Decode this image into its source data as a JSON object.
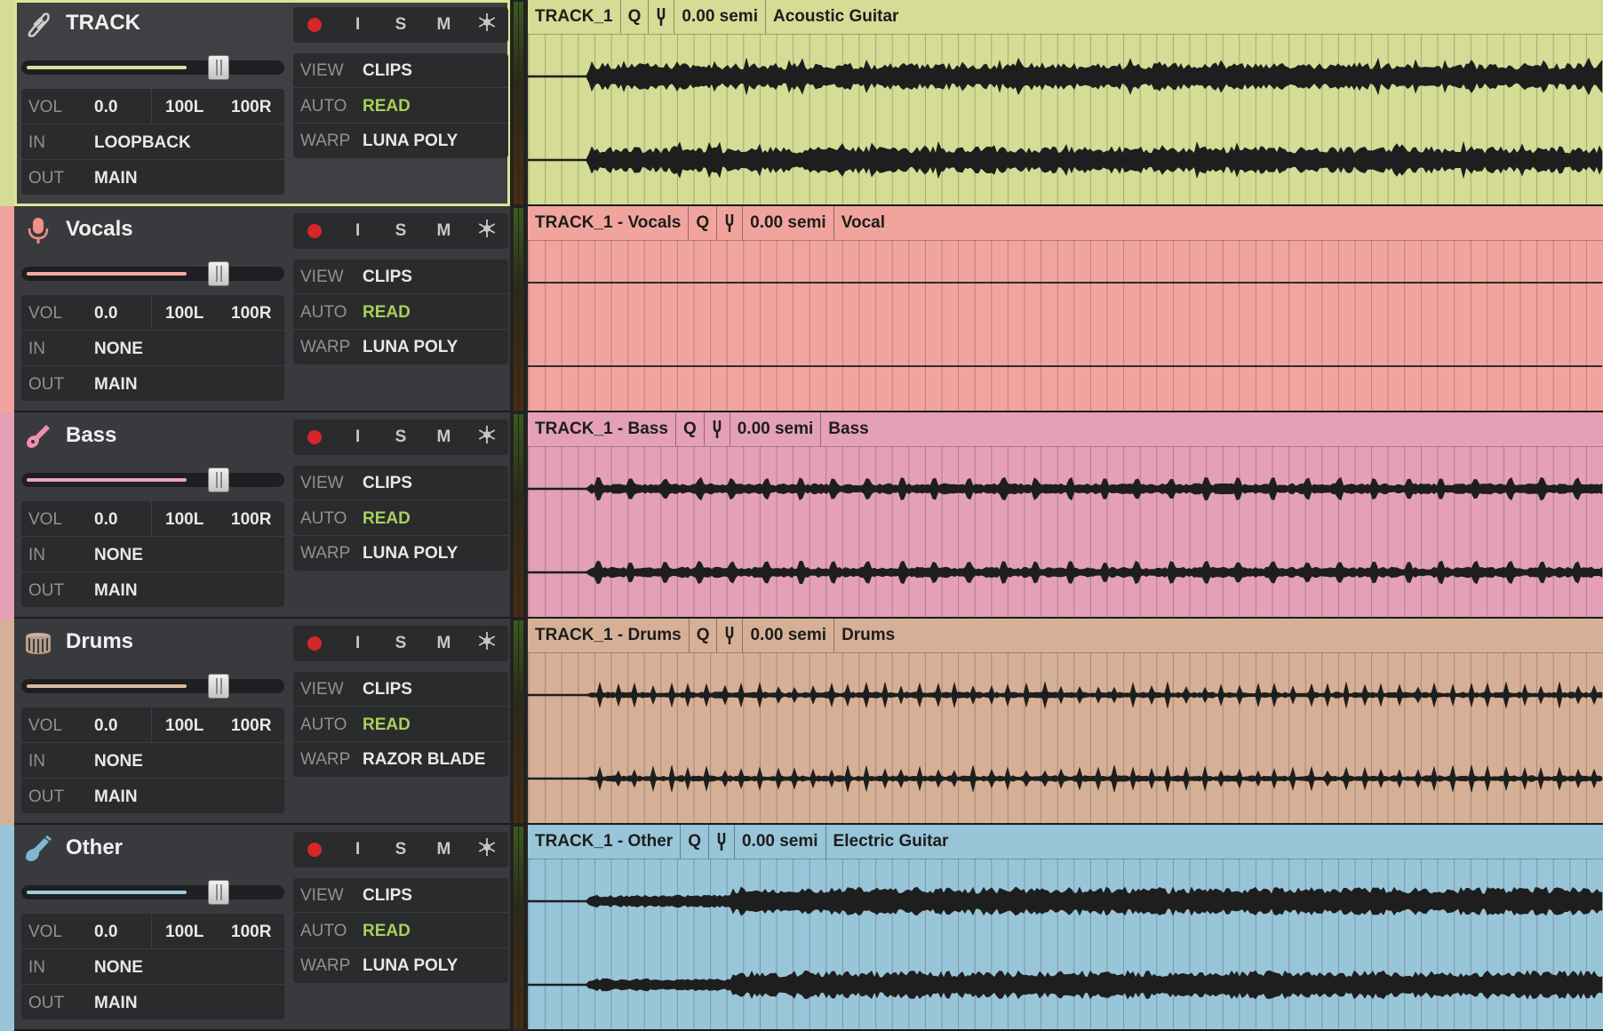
{
  "button_labels": {
    "input": "I",
    "solo": "S",
    "mute": "M"
  },
  "row_labels": {
    "vol": "VOL",
    "in": "IN",
    "out": "OUT",
    "view": "VIEW",
    "auto": "AUTO",
    "warp": "WARP"
  },
  "tracks": [
    {
      "name": "TRACK",
      "icon": "guitar-pick-icon",
      "color": "#d4dc95",
      "fader_color": "#d8df9a",
      "vol": "0.0",
      "pan_l": "100L",
      "pan_r": "100R",
      "in": "LOOPBACK",
      "out": "MAIN",
      "view": "CLIPS",
      "auto": "READ",
      "warp": "LUNA POLY",
      "clip": {
        "name": "TRACK_1",
        "q": "Q",
        "semi": "0.00 semi",
        "type": "Acoustic Guitar"
      }
    },
    {
      "name": "Vocals",
      "icon": "microphone-icon",
      "color": "#f1a49d",
      "fader_color": "#f4a8a2",
      "vol": "0.0",
      "pan_l": "100L",
      "pan_r": "100R",
      "in": "NONE",
      "out": "MAIN",
      "view": "CLIPS",
      "auto": "READ",
      "warp": "LUNA POLY",
      "clip": {
        "name": "TRACK_1 - Vocals",
        "q": "Q",
        "semi": "0.00 semi",
        "type": "Vocal"
      }
    },
    {
      "name": "Bass",
      "icon": "bass-guitar-icon",
      "color": "#e4a0b6",
      "fader_color": "#e9a5bb",
      "vol": "0.0",
      "pan_l": "100L",
      "pan_r": "100R",
      "in": "NONE",
      "out": "MAIN",
      "view": "CLIPS",
      "auto": "READ",
      "warp": "LUNA POLY",
      "clip": {
        "name": "TRACK_1 - Bass",
        "q": "Q",
        "semi": "0.00 semi",
        "type": "Bass"
      }
    },
    {
      "name": "Drums",
      "icon": "drum-icon",
      "color": "#d6b096",
      "fader_color": "#dcb89e",
      "vol": "0.0",
      "pan_l": "100L",
      "pan_r": "100R",
      "in": "NONE",
      "out": "MAIN",
      "view": "CLIPS",
      "auto": "READ",
      "warp": "RAZOR BLADE",
      "clip": {
        "name": "TRACK_1 - Drums",
        "q": "Q",
        "semi": "0.00 semi",
        "type": "Drums"
      }
    },
    {
      "name": "Other",
      "icon": "electric-guitar-icon",
      "color": "#99c5d9",
      "fader_color": "#9fcae0",
      "vol": "0.0",
      "pan_l": "100L",
      "pan_r": "100R",
      "in": "NONE",
      "out": "MAIN",
      "view": "CLIPS",
      "auto": "READ",
      "warp": "LUNA POLY",
      "clip": {
        "name": "TRACK_1 - Other",
        "q": "Q",
        "semi": "0.00 semi",
        "type": "Electric Guitar"
      }
    }
  ]
}
